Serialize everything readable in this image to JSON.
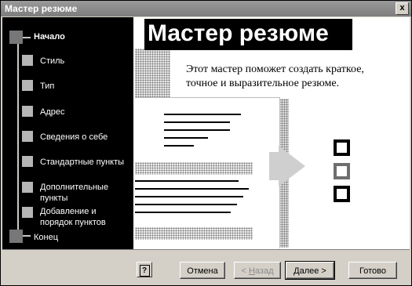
{
  "window": {
    "title": "Мастер резюме",
    "close_glyph": "x"
  },
  "header": {
    "title": "Мастер резюме"
  },
  "description": "Этот мастер поможет создать краткое, точное и выразительное резюме.",
  "steps": [
    {
      "label": "Начало",
      "current": true
    },
    {
      "label": "Стиль"
    },
    {
      "label": "Тип"
    },
    {
      "label": "Адрес"
    },
    {
      "label": "Сведения о себе"
    },
    {
      "label": "Стандартные пункты"
    },
    {
      "label": "Дополнительные пункты"
    },
    {
      "label": "Добавление и порядок пунктов"
    },
    {
      "label": "Конец"
    }
  ],
  "buttons": {
    "help": "?",
    "cancel": "Отмена",
    "back_prefix": "< ",
    "back_hotkey": "Н",
    "back_rest": "азад",
    "next_hotkey": "Д",
    "next_rest": "алее >",
    "finish": "Готово"
  },
  "icons": {
    "close": "close-icon",
    "help": "help-icon"
  }
}
